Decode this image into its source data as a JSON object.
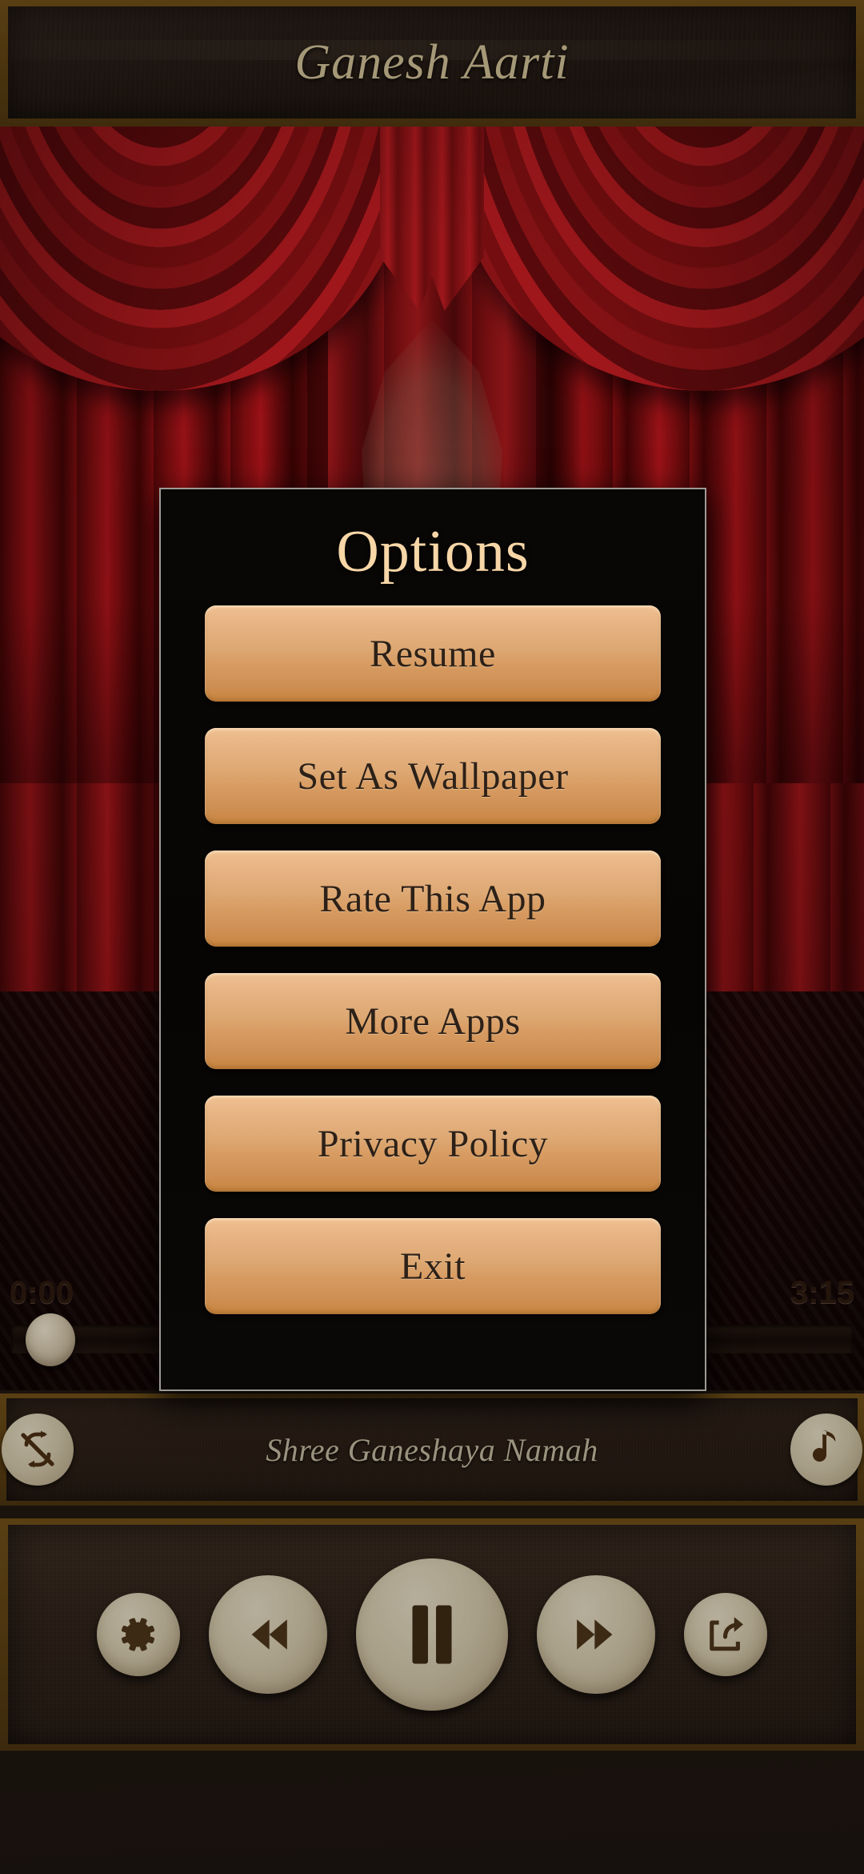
{
  "header": {
    "title": "Ganesh Aarti"
  },
  "player": {
    "current_time": "0:00",
    "total_time": "3:15",
    "progress_percent": 0,
    "song_title": "Shree Ganeshaya Namah",
    "repeat_icon": "repeat-off-icon",
    "note_icon": "music-note-icon",
    "controls": [
      {
        "name": "settings-button",
        "icon": "gear-icon",
        "size": "sm"
      },
      {
        "name": "rewind-button",
        "icon": "rewind-icon",
        "size": "md"
      },
      {
        "name": "pause-button",
        "icon": "pause-icon",
        "size": "lg"
      },
      {
        "name": "forward-button",
        "icon": "fast-forward-icon",
        "size": "md"
      },
      {
        "name": "share-button",
        "icon": "share-icon",
        "size": "sm"
      }
    ]
  },
  "dialog": {
    "title": "Options",
    "buttons": [
      {
        "label": "Resume",
        "name": "resume-button"
      },
      {
        "label": "Set As Wallpaper",
        "name": "set-as-wallpaper-button"
      },
      {
        "label": "Rate This App",
        "name": "rate-this-app-button"
      },
      {
        "label": "More Apps",
        "name": "more-apps-button"
      },
      {
        "label": "Privacy Policy",
        "name": "privacy-policy-button"
      },
      {
        "label": "Exit",
        "name": "exit-button"
      }
    ]
  },
  "colors": {
    "frame_gold": "#6d4d17",
    "header_text": "#a59877",
    "dialog_title": "#f7d6a7",
    "button_top": "#f0c191",
    "button_bottom": "#c8853f",
    "button_text": "#2d2118",
    "curtain_red": "#a3161a",
    "floor_wood": "#d9ae72",
    "control_circle": "#cec3a7"
  }
}
